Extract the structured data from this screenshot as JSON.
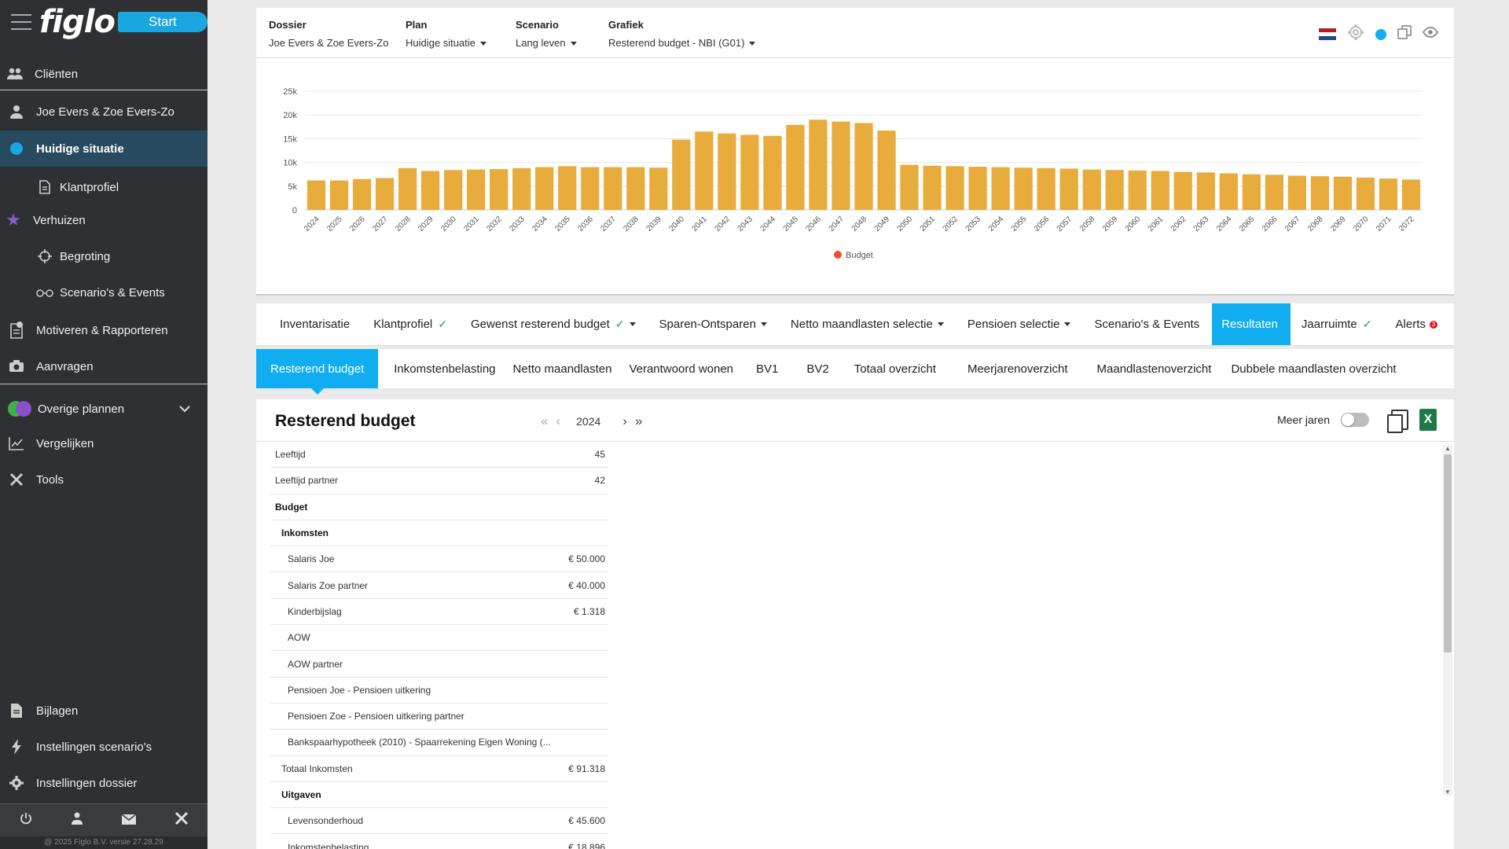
{
  "sidebar": {
    "logo": "figlo",
    "start_label": "Start",
    "items": [
      {
        "label": "Cliënten"
      },
      {
        "label": "Joe Evers & Zoe Evers-Zo"
      },
      {
        "label": "Huidige situatie"
      },
      {
        "label": "Klantprofiel"
      },
      {
        "label": "Verhuizen"
      },
      {
        "label": "Begroting"
      },
      {
        "label": "Scenario's & Events"
      },
      {
        "label": "Motiveren & Rapporteren"
      },
      {
        "label": "Aanvragen"
      },
      {
        "label": "Overige plannen"
      },
      {
        "label": "Vergelijken"
      },
      {
        "label": "Tools"
      },
      {
        "label": "Bijlagen"
      },
      {
        "label": "Instellingen scenario's"
      },
      {
        "label": "Instellingen dossier"
      }
    ],
    "copyright": "@ 2025 Figlo B.V. versie 27.28.29",
    "colors": {
      "bg": "#2f3033",
      "active": "#274a5e",
      "accent": "#1aa6e0"
    }
  },
  "topbar": {
    "dossier_label": "Dossier",
    "dossier_value": "Joe Evers & Zoe Evers-Zo",
    "plan_label": "Plan",
    "plan_value": "Huidige situatie",
    "scenario_label": "Scenario",
    "scenario_value": "Lang leven",
    "grafiek_label": "Grafiek",
    "grafiek_value": "Resterend budget - NBI (G01)",
    "icons": [
      "flag-nl-icon",
      "gear-icon",
      "status-dot-icon",
      "copy-icon",
      "eye-icon"
    ]
  },
  "chart_data": {
    "type": "bar",
    "categories": [
      "2024",
      "2025",
      "2026",
      "2027",
      "2028",
      "2029",
      "2030",
      "2031",
      "2032",
      "2033",
      "2034",
      "2035",
      "2036",
      "2037",
      "2038",
      "2039",
      "2040",
      "2041",
      "2042",
      "2043",
      "2044",
      "2045",
      "2046",
      "2047",
      "2048",
      "2049",
      "2050",
      "2051",
      "2052",
      "2053",
      "2054",
      "2055",
      "2056",
      "2057",
      "2058",
      "2059",
      "2060",
      "2061",
      "2062",
      "2063",
      "2064",
      "2065",
      "2066",
      "2067",
      "2068",
      "2069",
      "2070",
      "2071",
      "2072"
    ],
    "series": [
      {
        "name": "Budget",
        "color": "#e8ac3c",
        "values": [
          6200,
          6200,
          6500,
          6700,
          8800,
          8200,
          8400,
          8500,
          8600,
          8800,
          9000,
          9200,
          9000,
          9000,
          9000,
          8900,
          14800,
          16500,
          16100,
          15800,
          15600,
          17900,
          19000,
          18600,
          18300,
          16700,
          9500,
          9300,
          9200,
          9100,
          9000,
          8900,
          8800,
          8700,
          8500,
          8400,
          8300,
          8200,
          8000,
          7900,
          7700,
          7500,
          7400,
          7200,
          7100,
          7000,
          6800,
          6600,
          6400
        ]
      }
    ],
    "ylim": [
      0,
      25000
    ],
    "yticks": [
      "0",
      "5k",
      "10k",
      "15k",
      "20k",
      "25k"
    ],
    "grid": true,
    "legend": "bottom-center"
  },
  "tabs_primary": [
    {
      "label": "Inventarisatie",
      "check": false
    },
    {
      "label": "Klantprofiel",
      "check": true
    },
    {
      "label": "Gewenst resterend budget",
      "check": true,
      "dropdown": true
    },
    {
      "label": "Sparen-Ontsparen",
      "dropdown": true
    },
    {
      "label": "Netto maandlasten selectie",
      "dropdown": true
    },
    {
      "label": "Pensioen selectie",
      "dropdown": true
    },
    {
      "label": "Scenario's & Events"
    },
    {
      "label": "Resultaten",
      "active": true
    },
    {
      "label": "Jaarruimte",
      "check": true
    },
    {
      "label": "Alerts",
      "badge": "3"
    }
  ],
  "tabs_secondary": [
    {
      "label": "Resterend budget",
      "active": true
    },
    {
      "label": "Inkomstenbelasting"
    },
    {
      "label": "Netto maandlasten"
    },
    {
      "label": "Verantwoord wonen"
    },
    {
      "label": "BV1"
    },
    {
      "label": "BV2"
    },
    {
      "label": "Totaal overzicht"
    },
    {
      "label": "Meerjarenoverzicht"
    },
    {
      "label": "Maandlastenoverzicht"
    },
    {
      "label": "Dubbele maandlasten overzicht"
    }
  ],
  "content": {
    "title": "Resterend budget",
    "year": "2024",
    "meer_jaren_label": "Meer jaren",
    "rows": [
      {
        "label": "Leeftijd",
        "value": "45"
      },
      {
        "label": "Leeftijd partner",
        "value": "42"
      },
      {
        "label": "Budget",
        "value": ""
      },
      {
        "label": "Inkomsten",
        "value": ""
      },
      {
        "label": "Salaris Joe",
        "value": "€ 50.000"
      },
      {
        "label": "Salaris Zoe partner",
        "value": "€ 40.000"
      },
      {
        "label": "Kinderbijslag",
        "value": "€ 1.318"
      },
      {
        "label": "AOW",
        "value": ""
      },
      {
        "label": "AOW partner",
        "value": ""
      },
      {
        "label": "Pensioen Joe - Pensioen uitkering",
        "value": ""
      },
      {
        "label": "Pensioen Zoe - Pensioen uitkering partner",
        "value": ""
      },
      {
        "label": "Bankspaarhypotheek (2010) - Spaarrekening Eigen Woning (...",
        "value": ""
      },
      {
        "label": "Totaal Inkomsten",
        "value": "€ 91.318"
      },
      {
        "label": "Uitgaven",
        "value": ""
      },
      {
        "label": "Levensonderhoud",
        "value": "€ 45.600"
      },
      {
        "label": "Inkomstenbelasting",
        "value": "€ 18.896"
      }
    ]
  }
}
